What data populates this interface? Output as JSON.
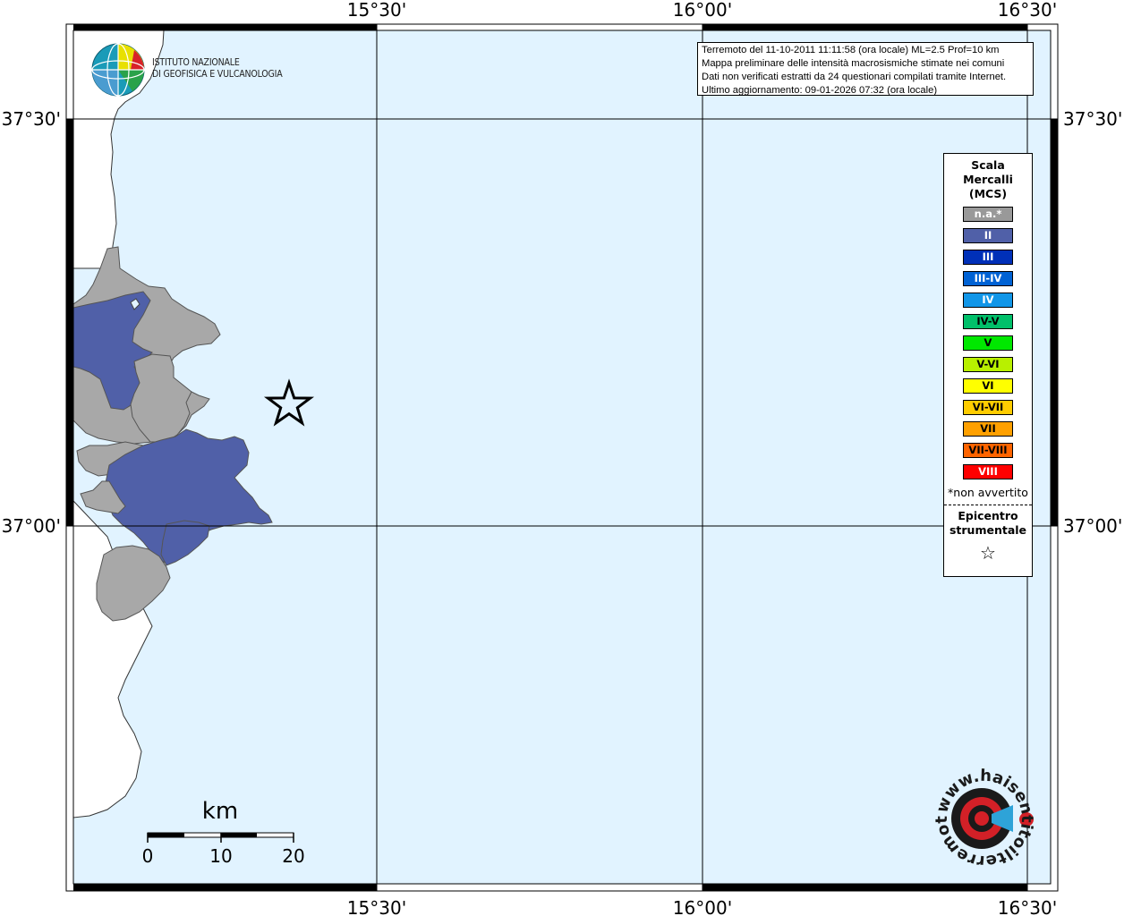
{
  "map": {
    "lon_labels": [
      "15°30'",
      "16°00'",
      "16°30'"
    ],
    "lat_labels": [
      "37°30'",
      "37°00'"
    ],
    "land_color": "#ffffff",
    "sea_color": "#e1f3ff"
  },
  "header": {
    "org_line1": "ISTITUTO NAZIONALE",
    "org_line2": "DI GEOFISICA E VULCANOLOGIA",
    "info_lines": [
      "Terremoto del 11-10-2011 11:11:58 (ora locale) ML=2.5 Prof=10 km",
      "Mappa preliminare delle intensità macrosismiche stimate nei comuni",
      "Dati non verificati estratti da 24 questionari compilati tramite Internet.",
      "Ultimo aggiornamento: 09-01-2026 07:32 (ora locale)"
    ]
  },
  "legend": {
    "title_lines": [
      "Scala",
      "Mercalli",
      "(MCS)"
    ],
    "items": [
      {
        "label": "n.a.*",
        "color": "#999999",
        "text": "light"
      },
      {
        "label": "II",
        "color": "#5060a8",
        "text": "light"
      },
      {
        "label": "III",
        "color": "#0030b8",
        "text": "light"
      },
      {
        "label": "III-IV",
        "color": "#0062d4",
        "text": "light"
      },
      {
        "label": "IV",
        "color": "#1196e8",
        "text": "light"
      },
      {
        "label": "IV-V",
        "color": "#00c06a",
        "text": "dark"
      },
      {
        "label": "V",
        "color": "#00e800",
        "text": "dark"
      },
      {
        "label": "V-VI",
        "color": "#b8f000",
        "text": "dark"
      },
      {
        "label": "VI",
        "color": "#ffff00",
        "text": "dark"
      },
      {
        "label": "VI-VII",
        "color": "#ffcc00",
        "text": "dark"
      },
      {
        "label": "VII",
        "color": "#ffa000",
        "text": "dark"
      },
      {
        "label": "VII-VIII",
        "color": "#ff6400",
        "text": "dark"
      },
      {
        "label": "VIII",
        "color": "#ff0000",
        "text": "light"
      }
    ],
    "note": "*non avvertito",
    "epicenter_lines": [
      "Epicentro",
      "strumentale"
    ],
    "epicenter_symbol": "☆"
  },
  "scale_bar": {
    "unit": "km",
    "ticks": [
      "0",
      "10",
      "20"
    ]
  },
  "watermark": {
    "text": "www.haisentitoilterremoto.it"
  },
  "epicenter_icon": "star-icon"
}
